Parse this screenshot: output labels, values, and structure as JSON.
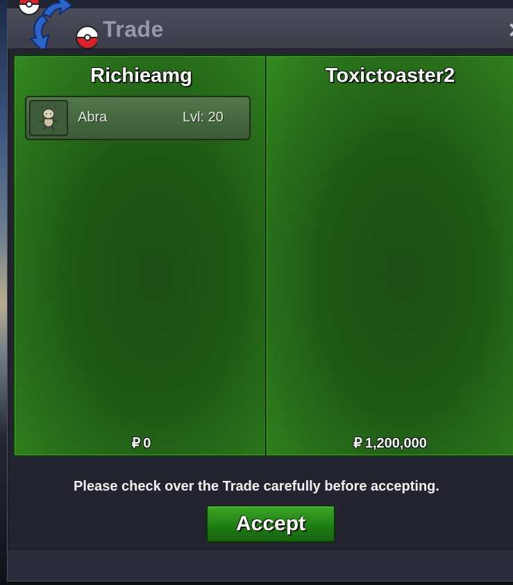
{
  "window": {
    "title": "Trade",
    "close_glyph": "✕",
    "logo_icon": "trade-swap-pokeball-icon"
  },
  "colors": {
    "panel_green": "#205a16",
    "accept_green": "#2a8f1c",
    "window_bg": "#2c2d3a"
  },
  "left_panel": {
    "player_name": "Richieamg",
    "items": [
      {
        "icon": "abra-sprite-icon",
        "name": "Abra",
        "level": "Lvl: 20"
      }
    ],
    "money_symbol": "₽",
    "money": "0"
  },
  "right_panel": {
    "player_name": "Toxictoaster2",
    "items": [],
    "money_symbol": "₽",
    "money": "1,200,000"
  },
  "footer": {
    "notice": "Please check over the Trade carefully before accepting.",
    "accept_label": "Accept"
  }
}
